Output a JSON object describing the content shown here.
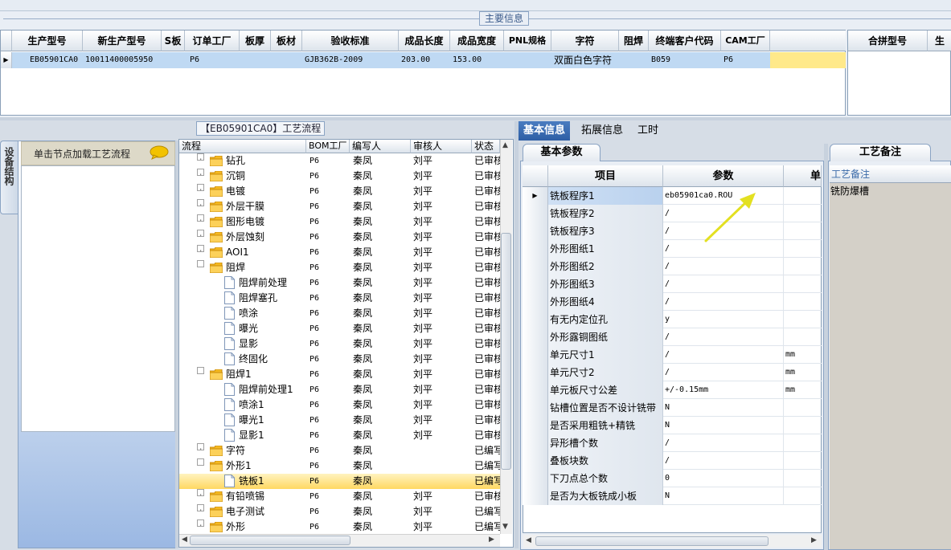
{
  "main_info": {
    "title": "主要信息",
    "columns": [
      "生产型号",
      "新生产型号",
      "S板",
      "订单工厂",
      "板厚",
      "板材",
      "验收标准",
      "成品长度",
      "成品宽度",
      "PNL规格",
      "字符",
      "阻焊",
      "终端客户代码",
      "CAM工厂"
    ],
    "row": [
      "EB05901CA0",
      "10011400005950",
      "",
      "P6",
      "",
      "",
      "GJB362B-2009",
      "203.00",
      "153.00",
      "",
      "双面白色字符",
      "",
      "B059",
      "P6"
    ],
    "side_columns": [
      "合拼型号",
      "生"
    ]
  },
  "left_panel": {
    "vertical_tab": "设备结构",
    "hint": "单击节点加载工艺流程"
  },
  "tree": {
    "title": "【EB05901CA0】工艺流程",
    "columns": [
      "流程",
      "BOM工厂",
      "编写人",
      "审核人",
      "状态"
    ],
    "rows": [
      {
        "name": "钻孔",
        "bom": "P6",
        "writer": "秦凤",
        "reviewer": "刘平",
        "status": "已审核",
        "level": 0,
        "exp": "+"
      },
      {
        "name": "沉铜",
        "bom": "P6",
        "writer": "秦凤",
        "reviewer": "刘平",
        "status": "已审核",
        "level": 0,
        "exp": "+"
      },
      {
        "name": "电镀",
        "bom": "P6",
        "writer": "秦凤",
        "reviewer": "刘平",
        "status": "已审核",
        "level": 0,
        "exp": "+"
      },
      {
        "name": "外层干膜",
        "bom": "P6",
        "writer": "秦凤",
        "reviewer": "刘平",
        "status": "已审核",
        "level": 0,
        "exp": "+"
      },
      {
        "name": "图形电镀",
        "bom": "P6",
        "writer": "秦凤",
        "reviewer": "刘平",
        "status": "已审核",
        "level": 0,
        "exp": "+"
      },
      {
        "name": "外层蚀刻",
        "bom": "P6",
        "writer": "秦凤",
        "reviewer": "刘平",
        "status": "已审核",
        "level": 0,
        "exp": "+"
      },
      {
        "name": "AOI1",
        "bom": "P6",
        "writer": "秦凤",
        "reviewer": "刘平",
        "status": "已审核",
        "level": 0,
        "exp": "+"
      },
      {
        "name": "阻焊",
        "bom": "P6",
        "writer": "秦凤",
        "reviewer": "刘平",
        "status": "已审核",
        "level": 0,
        "exp": "-"
      },
      {
        "name": "阻焊前处理",
        "bom": "P6",
        "writer": "秦凤",
        "reviewer": "刘平",
        "status": "已审核",
        "level": 1
      },
      {
        "name": "阻焊塞孔",
        "bom": "P6",
        "writer": "秦凤",
        "reviewer": "刘平",
        "status": "已审核",
        "level": 1
      },
      {
        "name": "喷涂",
        "bom": "P6",
        "writer": "秦凤",
        "reviewer": "刘平",
        "status": "已审核",
        "level": 1
      },
      {
        "name": "曝光",
        "bom": "P6",
        "writer": "秦凤",
        "reviewer": "刘平",
        "status": "已审核",
        "level": 1
      },
      {
        "name": "显影",
        "bom": "P6",
        "writer": "秦凤",
        "reviewer": "刘平",
        "status": "已审核",
        "level": 1
      },
      {
        "name": "终固化",
        "bom": "P6",
        "writer": "秦凤",
        "reviewer": "刘平",
        "status": "已审核",
        "level": 1
      },
      {
        "name": "阻焊1",
        "bom": "P6",
        "writer": "秦凤",
        "reviewer": "刘平",
        "status": "已审核",
        "level": 0,
        "exp": "-"
      },
      {
        "name": "阻焊前处理1",
        "bom": "P6",
        "writer": "秦凤",
        "reviewer": "刘平",
        "status": "已审核",
        "level": 1
      },
      {
        "name": "喷涂1",
        "bom": "P6",
        "writer": "秦凤",
        "reviewer": "刘平",
        "status": "已审核",
        "level": 1
      },
      {
        "name": "曝光1",
        "bom": "P6",
        "writer": "秦凤",
        "reviewer": "刘平",
        "status": "已审核",
        "level": 1
      },
      {
        "name": "显影1",
        "bom": "P6",
        "writer": "秦凤",
        "reviewer": "刘平",
        "status": "已审核",
        "level": 1
      },
      {
        "name": "字符",
        "bom": "P6",
        "writer": "秦凤",
        "reviewer": "",
        "status": "已编写",
        "level": 0,
        "exp": "+"
      },
      {
        "name": "外形1",
        "bom": "P6",
        "writer": "秦凤",
        "reviewer": "",
        "status": "已编写",
        "level": 0,
        "exp": "-"
      },
      {
        "name": "铣板1",
        "bom": "P6",
        "writer": "秦凤",
        "reviewer": "",
        "status": "已编写",
        "level": 1,
        "selected": true
      },
      {
        "name": "有铅喷锡",
        "bom": "P6",
        "writer": "秦凤",
        "reviewer": "刘平",
        "status": "已审核",
        "level": 0,
        "exp": "+"
      },
      {
        "name": "电子测试",
        "bom": "P6",
        "writer": "秦凤",
        "reviewer": "刘平",
        "status": "已编写",
        "level": 0,
        "exp": "+"
      },
      {
        "name": "外形",
        "bom": "P6",
        "writer": "秦凤",
        "reviewer": "刘平",
        "status": "已编写",
        "level": 0,
        "exp": "+"
      }
    ]
  },
  "right_tabs": [
    "基本信息",
    "拓展信息",
    "工时"
  ],
  "params": {
    "subtab": "基本参数",
    "columns": [
      "项目",
      "参数",
      "单"
    ],
    "rows": [
      {
        "item": "铣板程序1",
        "value": "eb05901ca0.ROU",
        "unit": ""
      },
      {
        "item": "铣板程序2",
        "value": "/",
        "unit": ""
      },
      {
        "item": "铣板程序3",
        "value": "/",
        "unit": ""
      },
      {
        "item": "外形图纸1",
        "value": "/",
        "unit": ""
      },
      {
        "item": "外形图纸2",
        "value": "/",
        "unit": ""
      },
      {
        "item": "外形图纸3",
        "value": "/",
        "unit": ""
      },
      {
        "item": "外形图纸4",
        "value": "/",
        "unit": ""
      },
      {
        "item": "有无内定位孔",
        "value": "y",
        "unit": ""
      },
      {
        "item": "外形露铜图纸",
        "value": "/",
        "unit": ""
      },
      {
        "item": "单元尺寸1",
        "value": "/",
        "unit": "mm"
      },
      {
        "item": "单元尺寸2",
        "value": "/",
        "unit": "mm"
      },
      {
        "item": "单元板尺寸公差",
        "value": "+/-0.15mm",
        "unit": "mm"
      },
      {
        "item": "钻槽位置是否不设计铣带",
        "value": "N",
        "unit": ""
      },
      {
        "item": "是否采用粗铣+精铣",
        "value": "N",
        "unit": ""
      },
      {
        "item": "异形槽个数",
        "value": "/",
        "unit": ""
      },
      {
        "item": "叠板块数",
        "value": "/",
        "unit": ""
      },
      {
        "item": "下刀点总个数",
        "value": "0",
        "unit": ""
      },
      {
        "item": "是否为大板铣成小板",
        "value": "N",
        "unit": ""
      }
    ]
  },
  "remark": {
    "tab": "工艺备注",
    "header": "工艺备注",
    "value": "铣防爆槽"
  }
}
